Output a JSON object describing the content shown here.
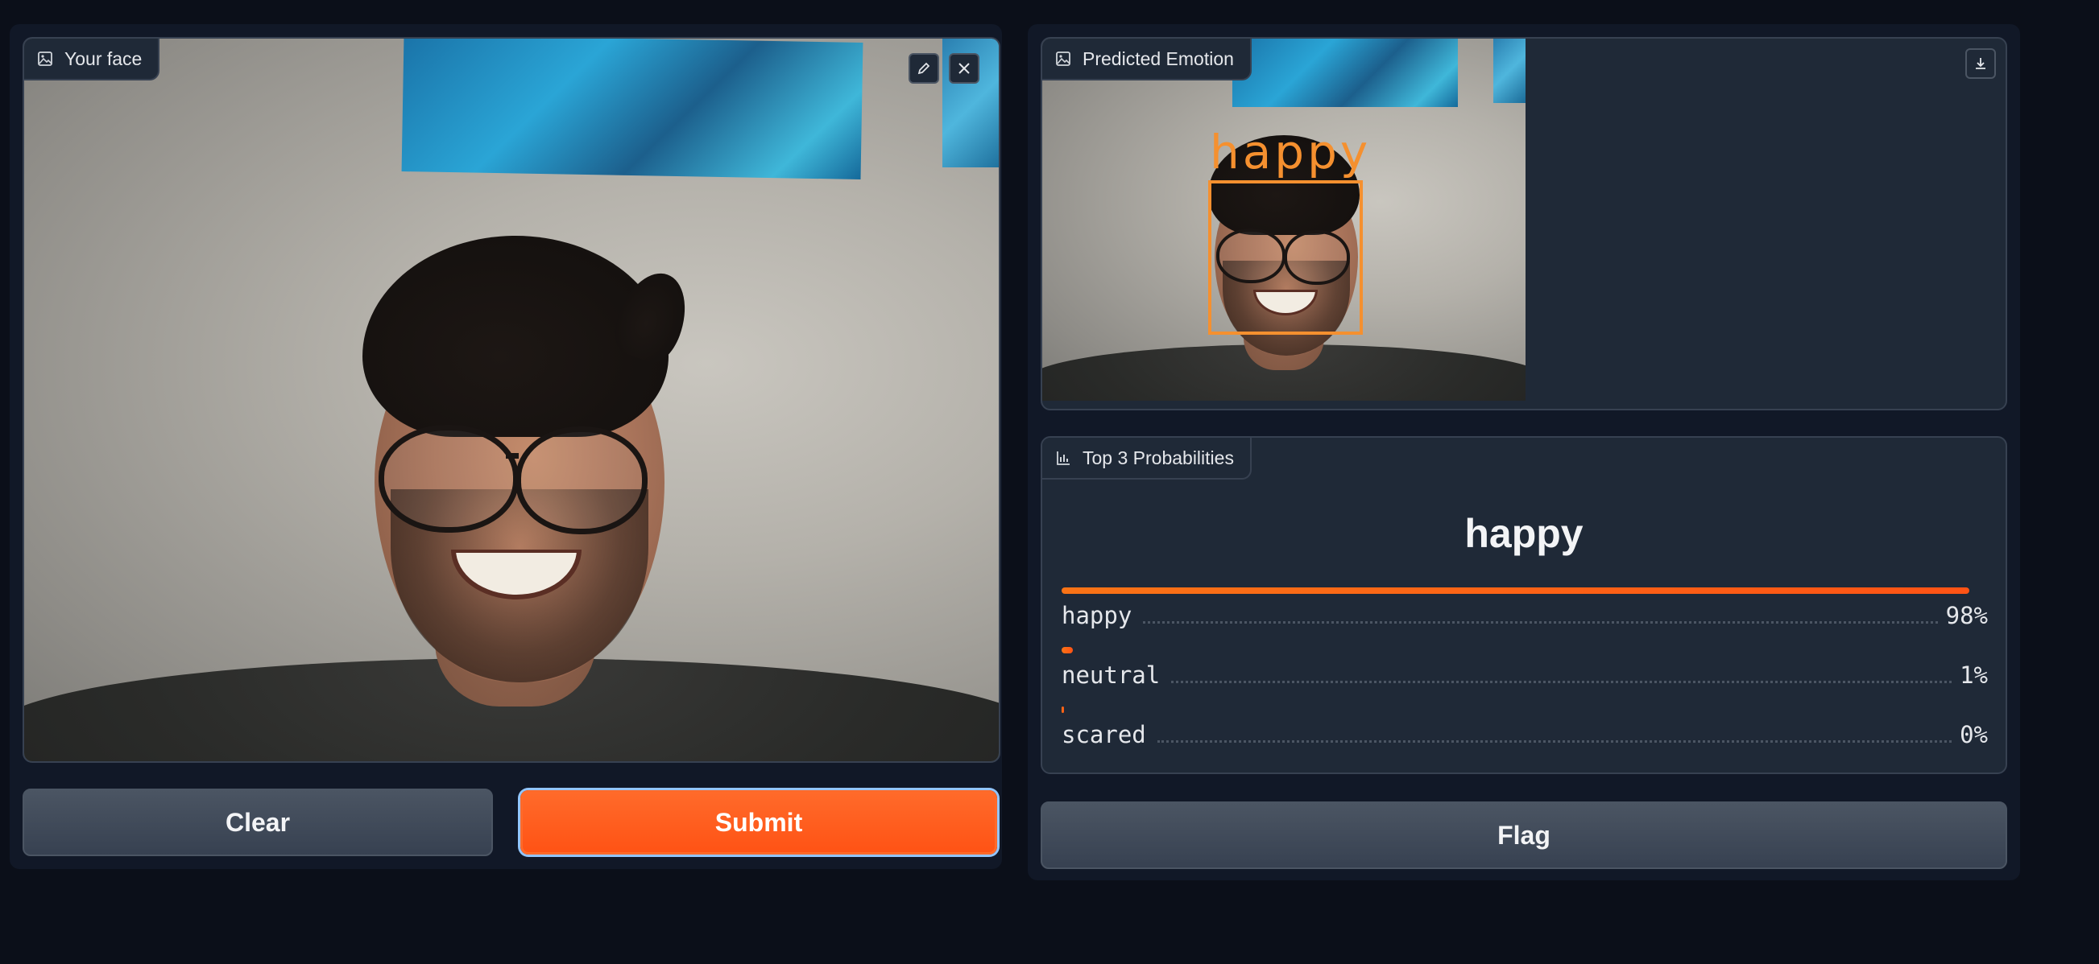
{
  "input": {
    "label": "Your face",
    "edit_icon": "pencil-icon",
    "clear_icon": "close-icon"
  },
  "actions": {
    "clear_label": "Clear",
    "submit_label": "Submit",
    "flag_label": "Flag"
  },
  "output_image": {
    "label": "Predicted Emotion",
    "detection_label": "happy",
    "download_icon": "download-icon"
  },
  "probabilities": {
    "label": "Top 3 Probabilities",
    "top_label": "happy",
    "items": [
      {
        "label": "happy",
        "value_text": "98%",
        "fraction": 0.98
      },
      {
        "label": "neutral",
        "value_text": "1%",
        "fraction": 0.012
      },
      {
        "label": "scared",
        "value_text": "0%",
        "fraction": 0.002
      }
    ]
  },
  "colors": {
    "accent": "#ff5315",
    "background": "#0b0f19",
    "panel": "#111827",
    "block": "#1f2937",
    "detection": "#f5902f"
  }
}
